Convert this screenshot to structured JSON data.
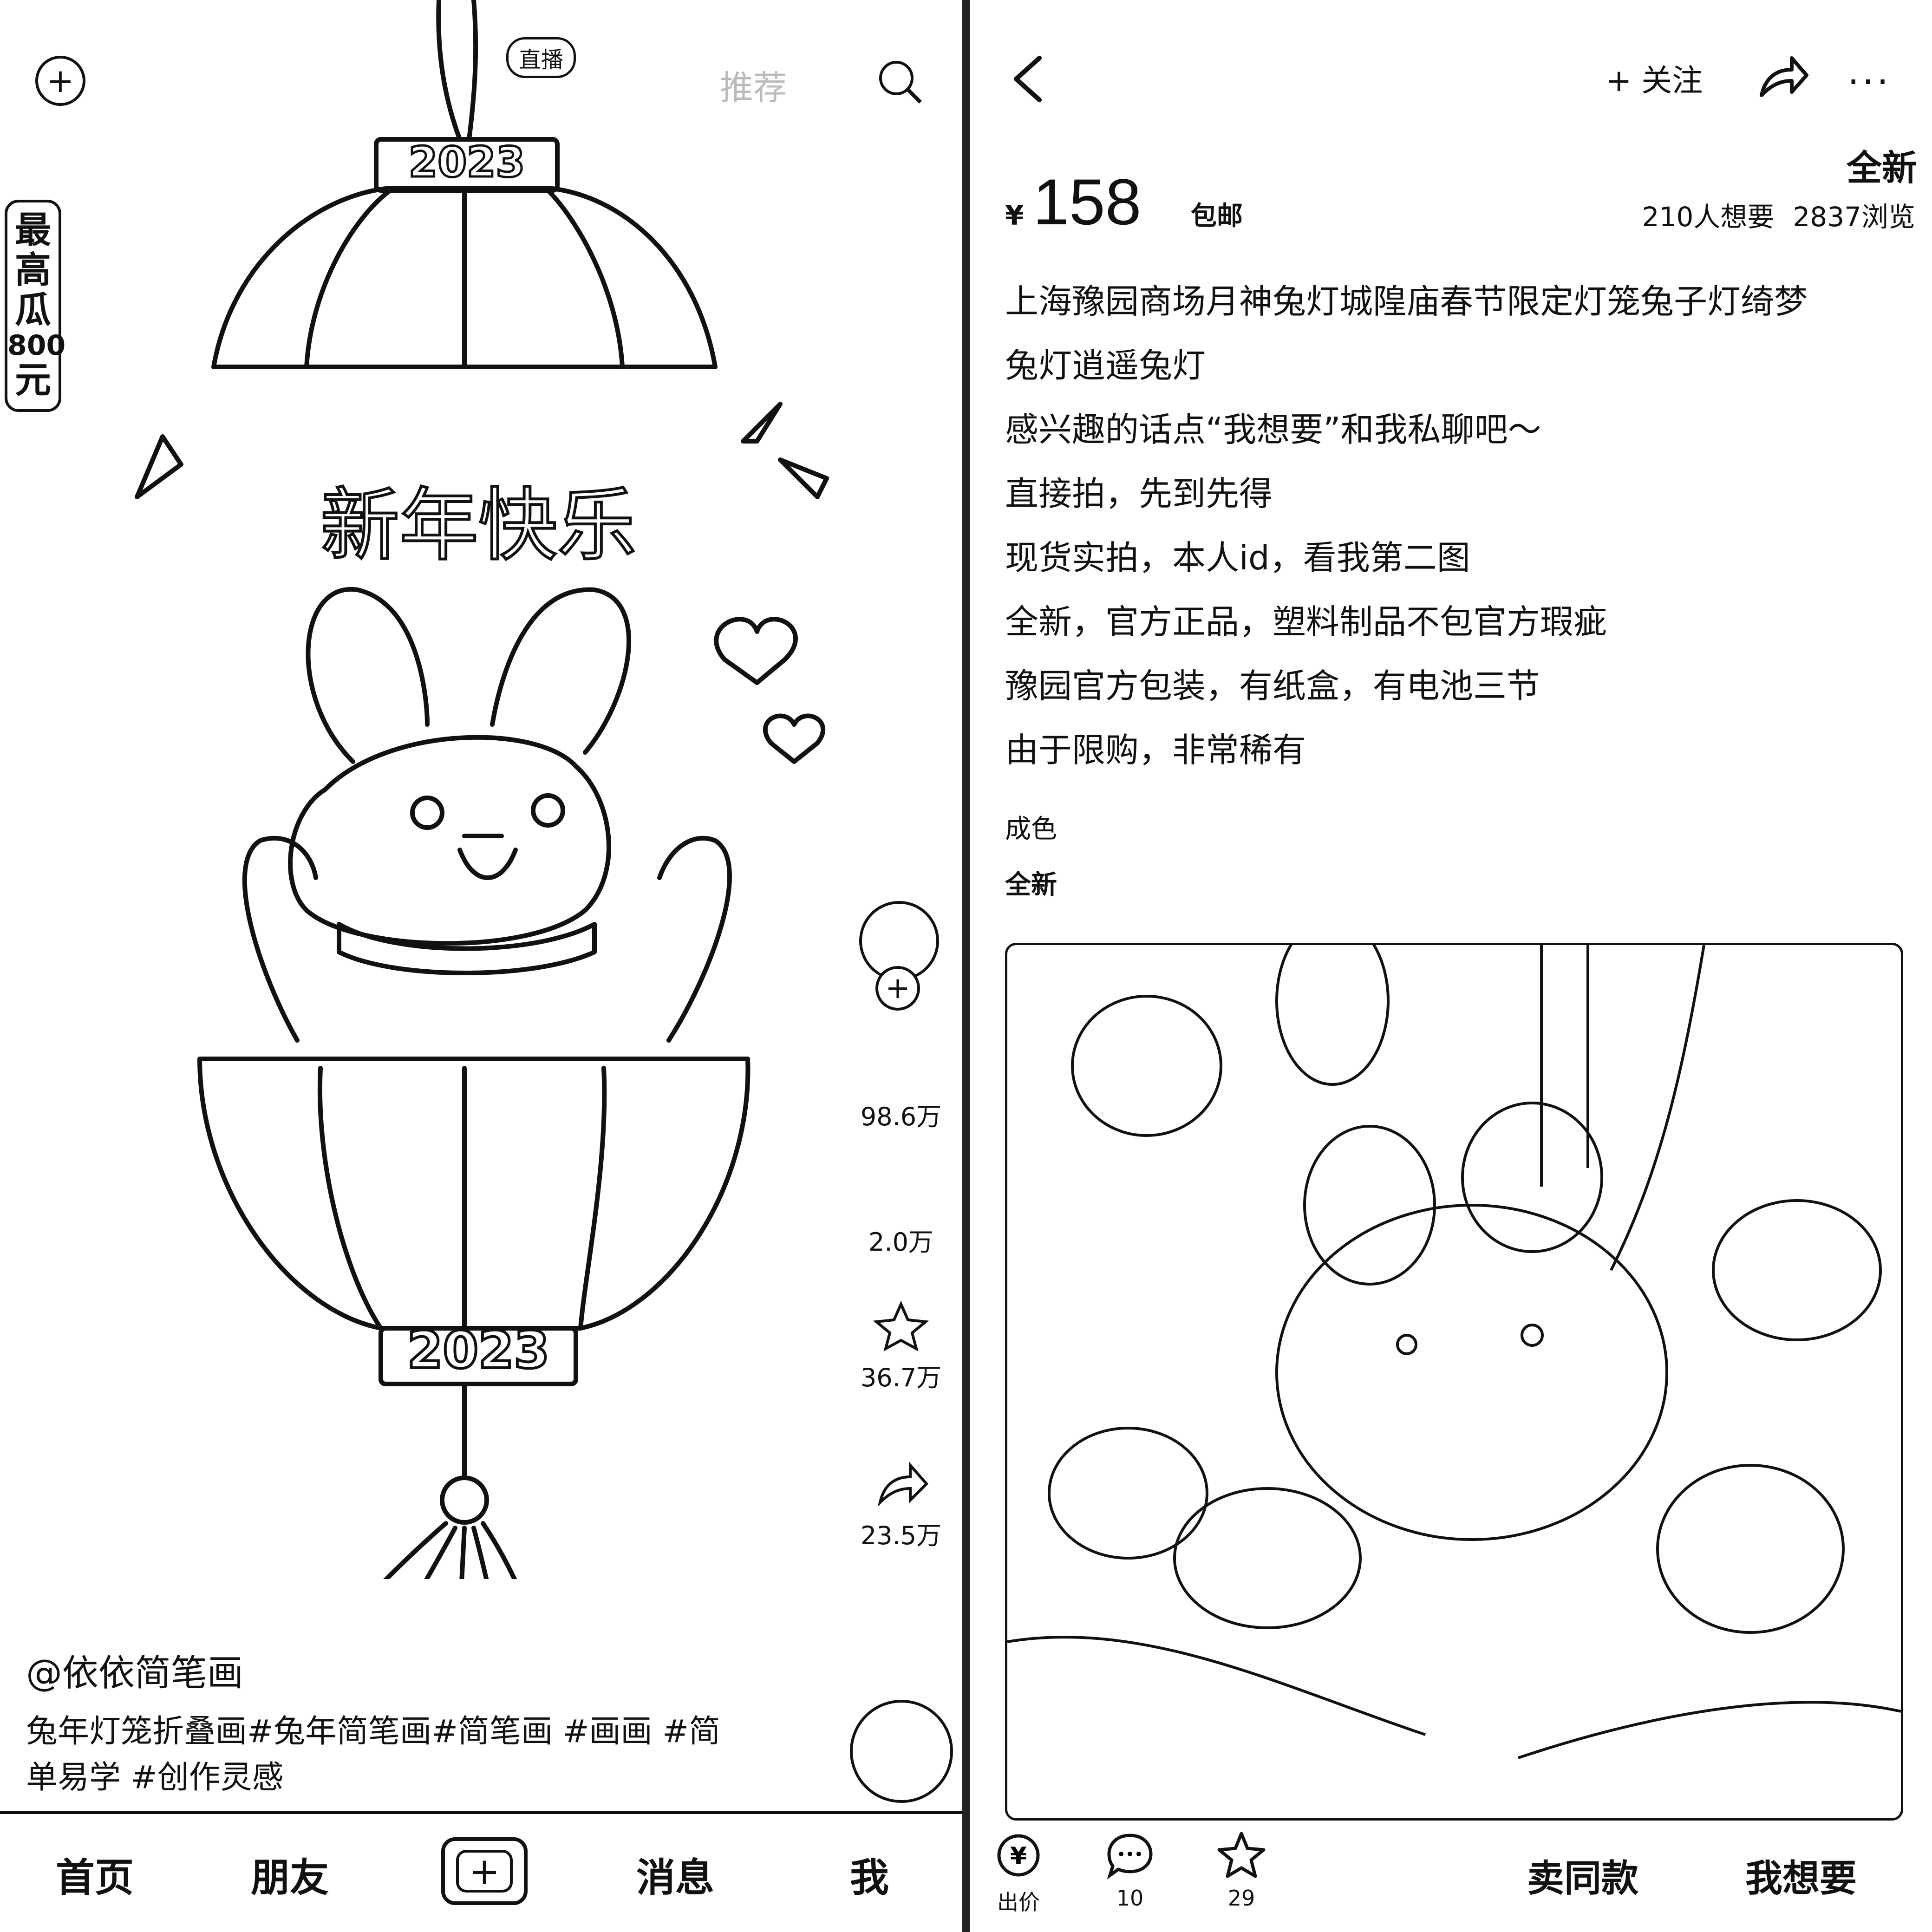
{
  "left": {
    "top_tabs": [
      "直播",
      "推荐"
    ],
    "promo": [
      "最",
      "高",
      "瓜",
      "800",
      "元"
    ],
    "artwork": {
      "banner_text": "新年快乐",
      "year_top": "2023",
      "year_bottom": "2023"
    },
    "side": {
      "likes": "98.6万",
      "comments": "2.0万",
      "favorites": "36.7万",
      "shares": "23.5万"
    },
    "author": "@依依简笔画",
    "caption": "兔年灯笼折叠画#兔年简笔画#简笔画 #画画 #简单易学 #创作灵感",
    "nav": {
      "home": "首页",
      "friends": "朋友",
      "messages": "消息",
      "me": "我"
    }
  },
  "right": {
    "follow_label": "+ 关注",
    "condition_tag": "全新",
    "currency": "¥",
    "price": "158",
    "shipping": "包邮",
    "wants": "210人想要",
    "views": "2837浏览",
    "description": [
      "上海豫园商场月神兔灯城隍庙春节限定灯笼兔子灯绮梦",
      "兔灯逍遥兔灯",
      "感兴趣的话点“我想要”和我私聊吧～",
      "直接拍，先到先得",
      "现货实拍，本人id，看我第二图",
      "全新，官方正品，塑料制品不包官方瑕疵",
      "豫园官方包装，有纸盒，有电池三节",
      "由于限购，非常稀有"
    ],
    "condition_label": "成色",
    "condition_value": "全新",
    "bottom": {
      "offer": "出价",
      "comments": "10",
      "favorites": "29",
      "sell_same": "卖同款",
      "want": "我想要"
    }
  }
}
